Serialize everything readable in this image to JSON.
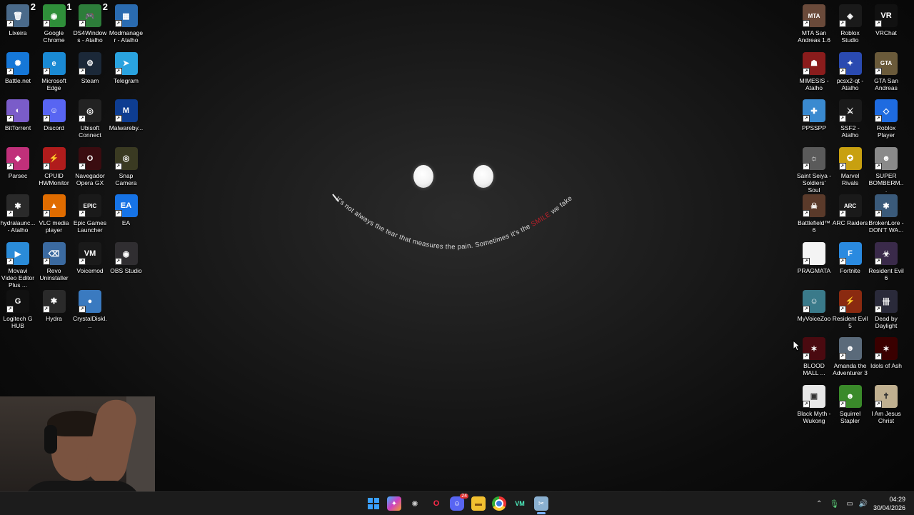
{
  "desktop": {
    "left_icons": [
      {
        "label": "Lixeira",
        "name": "recycle-bin-icon",
        "bg": "#4a6a8a",
        "glyph": "🗑",
        "badge": "2"
      },
      {
        "label": "Google Chrome",
        "name": "chrome-icon",
        "bg": "#2f8f3a",
        "glyph": "◉",
        "badge": "1"
      },
      {
        "label": "DS4Windows - Atalho",
        "name": "ds4windows-icon",
        "bg": "#2d7d3a",
        "glyph": "🎮",
        "badge": "2"
      },
      {
        "label": "Modmanager - Atalho",
        "name": "modmanager-icon",
        "bg": "#2a6bb0",
        "glyph": "▦",
        "badge": ""
      },
      {
        "label": "Battle.net",
        "name": "battlenet-icon",
        "bg": "#1577d8",
        "glyph": "✺",
        "badge": ""
      },
      {
        "label": "Microsoft Edge",
        "name": "edge-icon",
        "bg": "#1a8ad4",
        "glyph": "e",
        "badge": ""
      },
      {
        "label": "Steam",
        "name": "steam-icon",
        "bg": "#1b2838",
        "glyph": "⚙",
        "badge": ""
      },
      {
        "label": "Telegram",
        "name": "telegram-icon",
        "bg": "#2aa3df",
        "glyph": "➤",
        "badge": ""
      },
      {
        "label": "BitTorrent",
        "name": "bittorrent-icon",
        "bg": "#7a5cc9",
        "glyph": "◐",
        "badge": ""
      },
      {
        "label": "Discord",
        "name": "discord-icon",
        "bg": "#5865f2",
        "glyph": "☺",
        "badge": ""
      },
      {
        "label": "Ubisoft Connect",
        "name": "ubisoft-icon",
        "bg": "#222",
        "glyph": "◎",
        "badge": ""
      },
      {
        "label": "Malwareby...",
        "name": "malwarebytes-icon",
        "bg": "#0e3d91",
        "glyph": "M",
        "badge": ""
      },
      {
        "label": "Parsec",
        "name": "parsec-icon",
        "bg": "#c0307a",
        "glyph": "◆",
        "badge": ""
      },
      {
        "label": "CPUID HWMonitor",
        "name": "hwmonitor-icon",
        "bg": "#b01c1c",
        "glyph": "⚡",
        "badge": ""
      },
      {
        "label": "Navegador Opera GX",
        "name": "opera-gx-icon",
        "bg": "#3a0c10",
        "glyph": "O",
        "badge": ""
      },
      {
        "label": "Snap Camera",
        "name": "snap-camera-icon",
        "bg": "#3a3a22",
        "glyph": "◎",
        "badge": ""
      },
      {
        "label": "hydralaunc... - Atalho",
        "name": "hydra-launcher-icon",
        "bg": "#2a2a2a",
        "glyph": "✱",
        "badge": ""
      },
      {
        "label": "VLC media player",
        "name": "vlc-icon",
        "bg": "#e06c00",
        "glyph": "▲",
        "badge": ""
      },
      {
        "label": "Epic Games Launcher",
        "name": "epic-games-icon",
        "bg": "#1a1a1a",
        "glyph": "EPIC",
        "badge": ""
      },
      {
        "label": "EA",
        "name": "ea-icon",
        "bg": "#1673e6",
        "glyph": "EA",
        "badge": ""
      },
      {
        "label": "Movavi Video Editor Plus ...",
        "name": "movavi-icon",
        "bg": "#2a8bd8",
        "glyph": "▶",
        "badge": ""
      },
      {
        "label": "Revo Uninstaller",
        "name": "revo-uninstaller-icon",
        "bg": "#3b6aa0",
        "glyph": "⌫",
        "badge": ""
      },
      {
        "label": "Voicemod",
        "name": "voicemod-icon",
        "bg": "#1a1a1a",
        "glyph": "VM",
        "badge": ""
      },
      {
        "label": "OBS Studio",
        "name": "obs-icon",
        "bg": "#302e31",
        "glyph": "◉",
        "badge": ""
      },
      {
        "label": "Logitech G HUB",
        "name": "logitech-ghub-icon",
        "bg": "#111",
        "glyph": "G",
        "badge": ""
      },
      {
        "label": "Hydra",
        "name": "hydra-icon",
        "bg": "#2a2a2a",
        "glyph": "✱",
        "badge": ""
      },
      {
        "label": "CrystalDiskI...",
        "name": "crystaldiskinfo-icon",
        "bg": "#3a7ac0",
        "glyph": "●",
        "badge": ""
      }
    ],
    "right_icons": [
      {
        "label": "MTA San Andreas 1.6",
        "name": "mta-icon",
        "bg": "#6a4a3a",
        "glyph": "MTA"
      },
      {
        "label": "Roblox Studio",
        "name": "roblox-studio-icon",
        "bg": "#1a1a1a",
        "glyph": "◈"
      },
      {
        "label": "VRChat",
        "name": "vrchat-icon",
        "bg": "#111",
        "glyph": "VR"
      },
      {
        "label": "MIMESIS - Atalho",
        "name": "mimesis-icon",
        "bg": "#8a1c1c",
        "glyph": "☗"
      },
      {
        "label": "pcsx2-qt - Atalho",
        "name": "pcsx2-icon",
        "bg": "#2a4ab0",
        "glyph": "✦"
      },
      {
        "label": "GTA San Andreas",
        "name": "gta-sa-icon",
        "bg": "#6a5a3a",
        "glyph": "GTA"
      },
      {
        "label": "PPSSPP",
        "name": "ppsspp-icon",
        "bg": "#3a8ad0",
        "glyph": "✚"
      },
      {
        "label": "SSF2 - Atalho",
        "name": "ssf2-icon",
        "bg": "#1a1a1a",
        "glyph": "⚔"
      },
      {
        "label": "Roblox Player",
        "name": "roblox-player-icon",
        "bg": "#1e6be0",
        "glyph": "◇"
      },
      {
        "label": "Saint Seiya - Soldiers' Soul",
        "name": "saint-seiya-icon",
        "bg": "#5a5a5a",
        "glyph": "☼"
      },
      {
        "label": "Marvel Rivals",
        "name": "marvel-rivals-icon",
        "bg": "#c8a010",
        "glyph": "✪"
      },
      {
        "label": "SUPER BOMBERM...",
        "name": "super-bomberman-icon",
        "bg": "#8a8a8a",
        "glyph": "☻"
      },
      {
        "label": "Battlefield™ 6",
        "name": "battlefield-icon",
        "bg": "#5a3a2a",
        "glyph": "☠"
      },
      {
        "label": "ARC Raiders",
        "name": "arc-raiders-icon",
        "bg": "#1a1a1a",
        "glyph": "ARC"
      },
      {
        "label": "BrokenLore - DON'T WA...",
        "name": "brokenlore-icon",
        "bg": "#3a5a7a",
        "glyph": "✱"
      },
      {
        "label": "PRAGMATA",
        "name": "pragmata-icon",
        "bg": "#f4f4f4",
        "glyph": ""
      },
      {
        "label": "Fortnite",
        "name": "fortnite-icon",
        "bg": "#2a8ae0",
        "glyph": "F"
      },
      {
        "label": "Resident Evil 6",
        "name": "resident-evil-6-icon",
        "bg": "#3a2a4a",
        "glyph": "☣"
      },
      {
        "label": "MyVoiceZoo",
        "name": "myvoicezoo-icon",
        "bg": "#3a7a8a",
        "glyph": "☺"
      },
      {
        "label": "Resident Evil 5",
        "name": "resident-evil-5-icon",
        "bg": "#8a2a10",
        "glyph": "⚡"
      },
      {
        "label": "Dead by Daylight",
        "name": "dead-by-daylight-icon",
        "bg": "#2a2a3a",
        "glyph": "卌"
      },
      {
        "label": "BLOOD MALL ...",
        "name": "blood-mall-icon",
        "bg": "#4a0a10",
        "glyph": "✶"
      },
      {
        "label": "Amanda the Adventurer 3",
        "name": "amanda-adventurer-icon",
        "bg": "#5a6a7a",
        "glyph": "☻"
      },
      {
        "label": "Idols of Ash",
        "name": "idols-of-ash-icon",
        "bg": "#3a0000",
        "glyph": "✶"
      },
      {
        "label": "Black Myth - Wukong",
        "name": "black-myth-wukong-icon",
        "bg": "#e8e8e8",
        "glyph": "▣"
      },
      {
        "label": "Squirrel Stapler",
        "name": "squirrel-stapler-icon",
        "bg": "#3a8a2a",
        "glyph": "☻"
      },
      {
        "label": "I Am Jesus Christ",
        "name": "i-am-jesus-christ-icon",
        "bg": "#c0b090",
        "glyph": "✝"
      }
    ]
  },
  "wallpaper": {
    "quote_start": "It's not always the tear that measures the pain. Sometimes it's the ",
    "quote_highlight": "SMILE",
    "quote_end": " we fake",
    "highlight_color": "#c0202a",
    "text_color": "#dcdcdc"
  },
  "taskbar": {
    "icons": [
      "start-icon",
      "copilot-icon",
      "chatgpt-icon",
      "opera-gx-icon",
      "discord-icon",
      "file-explorer-icon",
      "chrome-icon",
      "voicemod-icon",
      "snipping-tool-icon"
    ],
    "discord_badge": "24",
    "time": "04:29",
    "date": "30/04/2026"
  }
}
